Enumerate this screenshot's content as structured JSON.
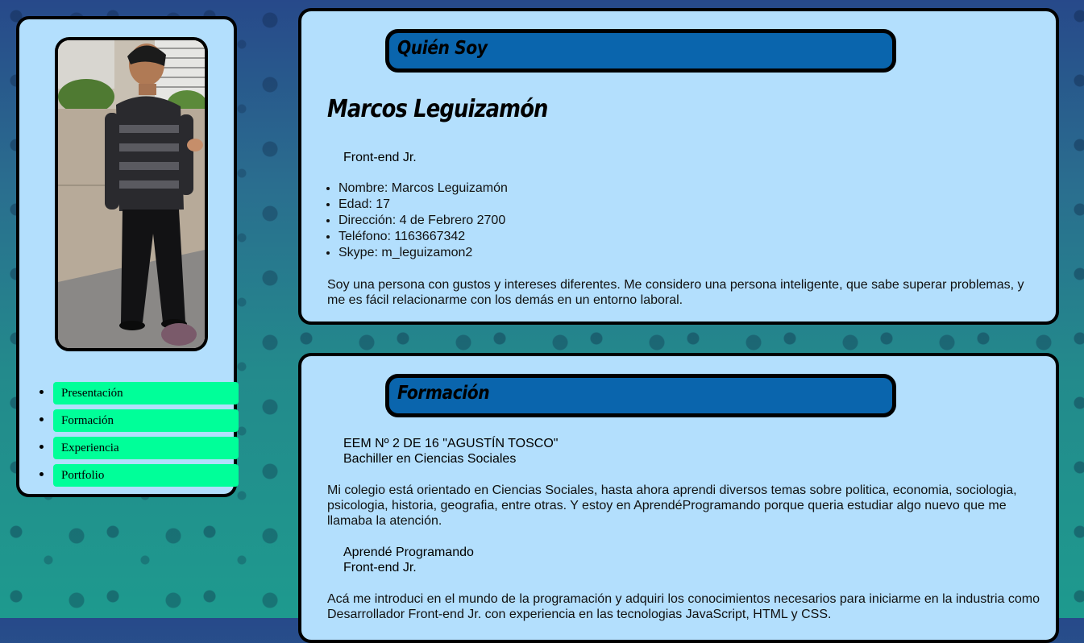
{
  "colors": {
    "card_bg": "#b3dffd",
    "header_bg": "#0a65ad",
    "nav_bg": "#00ff99",
    "border": "#000000"
  },
  "sidebar": {
    "photo_icon": "profile-photo",
    "nav": [
      {
        "label": "Presentación"
      },
      {
        "label": "Formación"
      },
      {
        "label": "Experiencia"
      },
      {
        "label": "Portfolio"
      }
    ]
  },
  "about": {
    "header": "Quién Soy",
    "name": "Marcos Leguizamón",
    "role": "Front-end Jr.",
    "details": [
      "Nombre: Marcos Leguizamón",
      "Edad: 17",
      "Dirección: 4 de Febrero 2700",
      "Teléfono: 1163667342",
      "Skype: m_leguizamon2"
    ],
    "description": "Soy una persona con gustos y intereses diferentes. Me considero una persona inteligente, que sabe superar problemas, y me es fácil relacionarme con los demás en un entorno laboral."
  },
  "education": {
    "header": "Formación",
    "items": [
      {
        "school": "EEM Nº 2 DE 16 \"AGUSTÍN TOSCO\"",
        "degree": "Bachiller en Ciencias Sociales",
        "description": "Mi colegio está orientado en Ciencias Sociales, hasta ahora aprendi diversos temas sobre politica, economia, sociologia, psicologia, historia, geografia, entre otras. Y estoy en AprendéProgramando porque queria estudiar algo nuevo que me llamaba la atención."
      },
      {
        "school": "Aprendé Programando",
        "degree": "Front-end Jr.",
        "description": "Acá me introduci en el mundo de la programación y adquiri los conocimientos necesarios para iniciarme en la industria como Desarrollador Front-end Jr. con experiencia en las tecnologias JavaScript, HTML y CSS."
      }
    ]
  }
}
